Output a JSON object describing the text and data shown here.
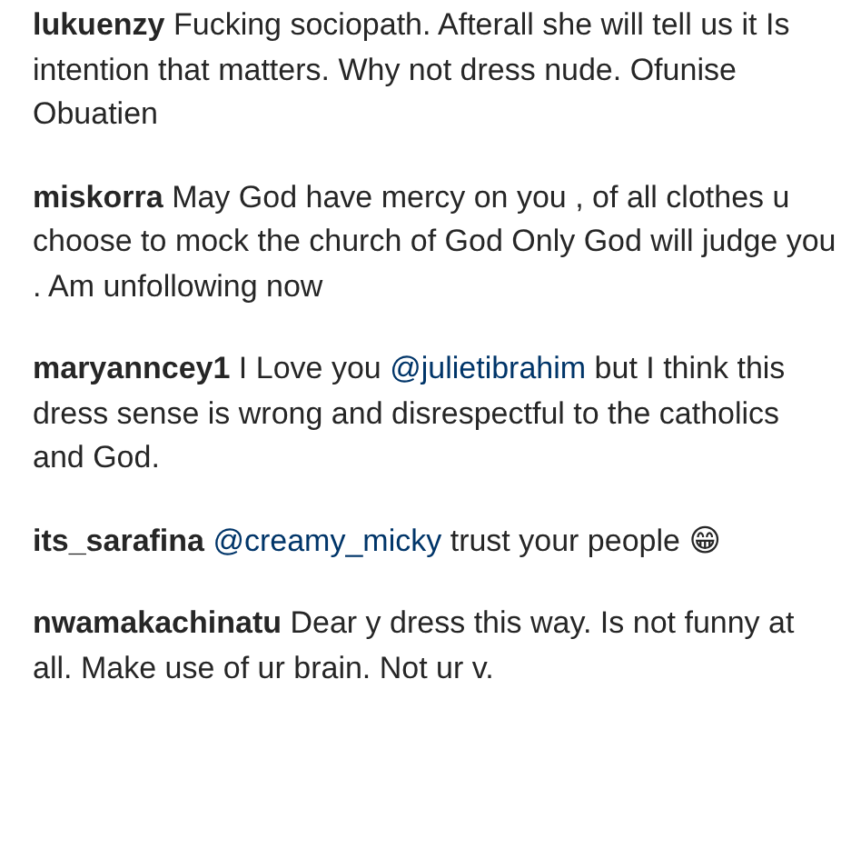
{
  "comments": [
    {
      "username": "lukuenzy",
      "parts": [
        {
          "kind": "text",
          "text": "Fucking sociopath. Afterall she will tell us it Is intention that matters. Why not dress nude. Ofunise Obuatien"
        }
      ]
    },
    {
      "username": "miskorra",
      "parts": [
        {
          "kind": "text",
          "text": "May God have mercy on you , of all clothes u choose to mock the church of God Only God will judge you . Am unfollowing now"
        }
      ]
    },
    {
      "username": "maryanncey1",
      "parts": [
        {
          "kind": "text",
          "text": "I Love you "
        },
        {
          "kind": "mention",
          "text": "@julietibrahim"
        },
        {
          "kind": "text",
          "text": " but I think this dress sense is wrong and disrespectful to the catholics and God."
        }
      ]
    },
    {
      "username": "its_sarafina",
      "parts": [
        {
          "kind": "mention",
          "text": "@creamy_micky"
        },
        {
          "kind": "text",
          "text": " trust your people 😁"
        }
      ]
    },
    {
      "username": "nwamakachinatu",
      "parts": [
        {
          "kind": "text",
          "text": "Dear y dress this way. Is not funny at all. Make use of ur brain. Not ur v."
        }
      ]
    }
  ]
}
